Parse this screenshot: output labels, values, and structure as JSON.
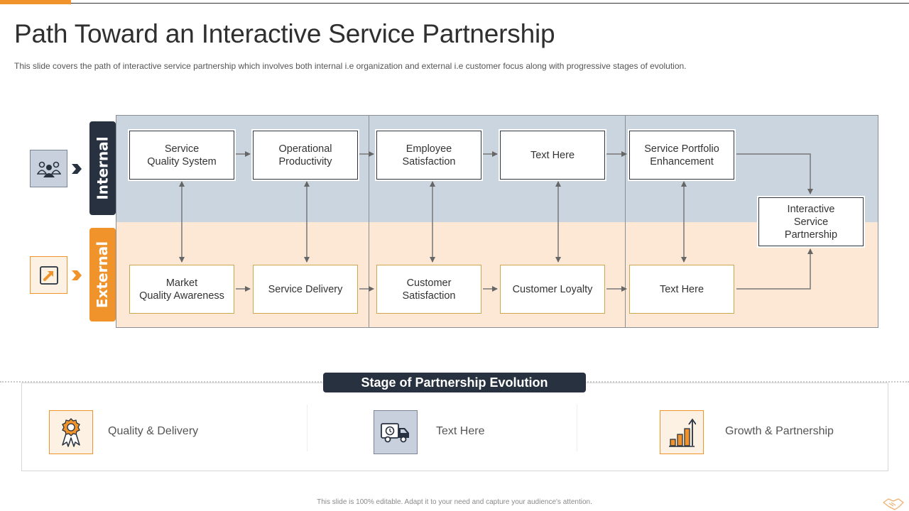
{
  "title": "Path Toward an Interactive Service Partnership",
  "subtitle": "This slide covers the path of interactive service partnership which involves  both internal i.e organization and external i.e customer focus along with progressive  stages of evolution.",
  "lanes": {
    "internal": "Internal",
    "external": "External"
  },
  "internal_boxes": [
    "Service\nQuality System",
    "Operational\nProductivity",
    "Employee\nSatisfaction",
    "Text Here",
    "Service Portfolio\nEnhancement"
  ],
  "external_boxes": [
    "Market\nQuality Awareness",
    "Service Delivery",
    "Customer\nSatisfaction",
    "Customer Loyalty",
    "Text Here"
  ],
  "final_box": "Interactive\nService\nPartnership",
  "stage": {
    "header": "Stage of Partnership Evolution",
    "items": [
      {
        "label": "Quality  & Delivery",
        "icon": "award-badge-icon"
      },
      {
        "label": "Text Here",
        "icon": "delivery-truck-icon"
      },
      {
        "label": "Growth  & Partnership",
        "icon": "growth-chart-icon"
      }
    ]
  },
  "footer": "This slide is 100% editable.  Adapt it to your need and capture your audience's attention.",
  "colors": {
    "accent_orange": "#f0932b",
    "dark_navy": "#27313f",
    "internal_band": "#cbd5e0",
    "external_band": "#fce8d4"
  }
}
